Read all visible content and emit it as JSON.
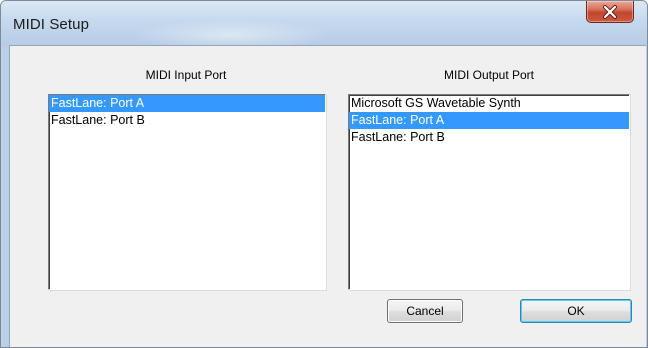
{
  "window": {
    "title": "MIDI Setup",
    "close_glyph": "close-icon"
  },
  "input_port": {
    "label": "MIDI Input Port",
    "items": [
      {
        "label": "FastLane: Port A",
        "selected": true
      },
      {
        "label": "FastLane: Port B",
        "selected": false
      }
    ]
  },
  "output_port": {
    "label": "MIDI Output Port",
    "items": [
      {
        "label": "Microsoft GS Wavetable Synth",
        "selected": false
      },
      {
        "label": "FastLane: Port A",
        "selected": true
      },
      {
        "label": "FastLane: Port B",
        "selected": false
      }
    ]
  },
  "buttons": {
    "cancel_label": "Cancel",
    "ok_label": "OK"
  },
  "colors": {
    "selection": "#3399ff",
    "close_button": "#c2452d"
  }
}
